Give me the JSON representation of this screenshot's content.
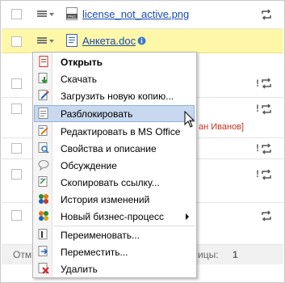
{
  "rows": [
    {
      "file": "license_not_active.png",
      "filetype": "PNG"
    },
    {
      "file": "Анкета.doc",
      "filetype": "DOC"
    }
  ],
  "partial": {
    "red_text": "ан Иванов]",
    "footer_left": "Отм",
    "footer_right": "ицы:",
    "footer_count": "1",
    "excl": "!"
  },
  "menu": {
    "items": [
      {
        "label": "Открыть",
        "icon": "open-doc-icon"
      },
      {
        "label": "Скачать",
        "icon": "download-icon"
      },
      {
        "label": "Загрузить новую копию...",
        "icon": "upload-copy-icon"
      },
      {
        "label": "Разблокировать",
        "icon": "unlock-icon"
      },
      {
        "label": "Редактировать в MS Office",
        "icon": "edit-office-icon"
      },
      {
        "label": "Свойства и описание",
        "icon": "properties-icon"
      },
      {
        "label": "Обсуждение",
        "icon": "discussion-icon"
      },
      {
        "label": "Скопировать ссылку...",
        "icon": "copy-link-icon"
      },
      {
        "label": "История изменений",
        "icon": "history-icon"
      },
      {
        "label": "Новый бизнес-процесс",
        "icon": "workflow-icon"
      },
      {
        "label": "Переименовать...",
        "icon": "rename-icon"
      },
      {
        "label": "Переместить...",
        "icon": "move-icon"
      },
      {
        "label": "Удалить",
        "icon": "delete-icon"
      }
    ]
  },
  "colors": {
    "highlight_row": "#fff7a8",
    "link": "#1a4ab0",
    "selected_item": "#c7d8ef"
  }
}
